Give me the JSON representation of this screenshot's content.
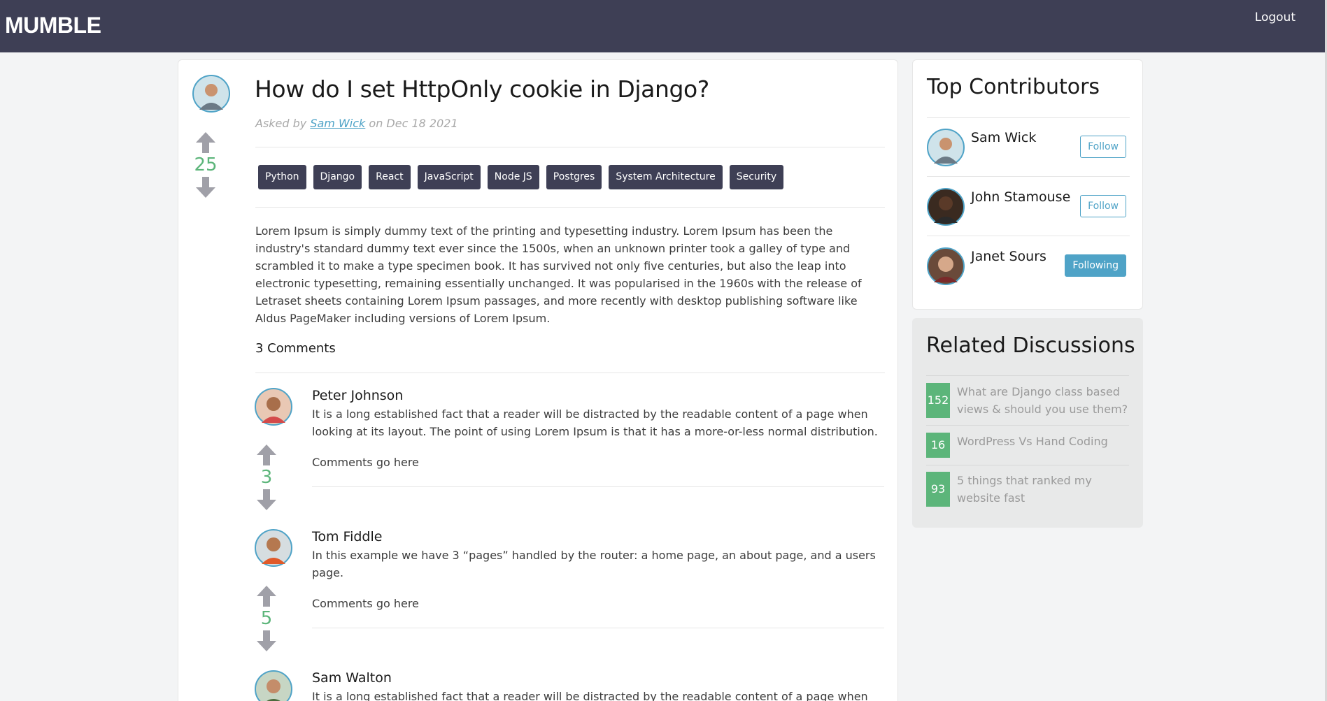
{
  "header": {
    "brand": "MUMBLE",
    "logout_label": "Logout"
  },
  "question": {
    "title": "How do I set HttpOnly cookie in Django?",
    "asked_by_prefix": "Asked by ",
    "author": "Sam Wick",
    "date_text": " on Dec 18 2021",
    "votes": "25",
    "tags": [
      "Python",
      "Django",
      "React",
      "JavaScript",
      "Node JS",
      "Postgres",
      "System Architecture",
      "Security"
    ],
    "body": "Lorem Ipsum is simply dummy text of the printing and typesetting industry. Lorem Ipsum has been the industry's standard dummy text ever since the 1500s, when an unknown printer took a galley of type and scrambled it to make a type specimen book. It has survived not only five centuries, but also the leap into electronic typesetting, remaining essentially unchanged. It was popularised in the 1960s with the release of Letraset sheets containing Lorem Ipsum passages, and more recently with desktop publishing software like Aldus PageMaker including versions of Lorem Ipsum.",
    "comments_count_label": "3 Comments"
  },
  "comments": [
    {
      "name": "Peter Johnson",
      "text": "It is a long established fact that a reader will be distracted by the readable content of a page when looking at its layout. The point of using Lorem Ipsum is that it has a more-or-less normal distribution.",
      "sub": "Comments go here",
      "votes": "3"
    },
    {
      "name": "Tom Fiddle",
      "text": "In this example we have 3 “pages” handled by the router: a home page, an about page, and a users page.",
      "sub": "Comments go here",
      "votes": "5"
    },
    {
      "name": "Sam Walton",
      "text": "It is a long established fact that a reader will be distracted by the readable content of a page when"
    }
  ],
  "contributors": {
    "title": "Top Contributors",
    "items": [
      {
        "name": "Sam Wick",
        "button": "Follow"
      },
      {
        "name": "John Stamouse",
        "button": "Follow"
      },
      {
        "name": "Janet Sours",
        "button": "Following"
      }
    ]
  },
  "related": {
    "title": "Related Discussions",
    "items": [
      {
        "count": "152",
        "text": "What are Django class based views & should you use them?"
      },
      {
        "count": "16",
        "text": "WordPress Vs Hand Coding"
      },
      {
        "count": "93",
        "text": "5 things that ranked my website fast"
      }
    ]
  },
  "colors": {
    "header": "#3e3f55",
    "accent_green": "#5cb57a",
    "accent_blue": "#4fa3c7"
  }
}
